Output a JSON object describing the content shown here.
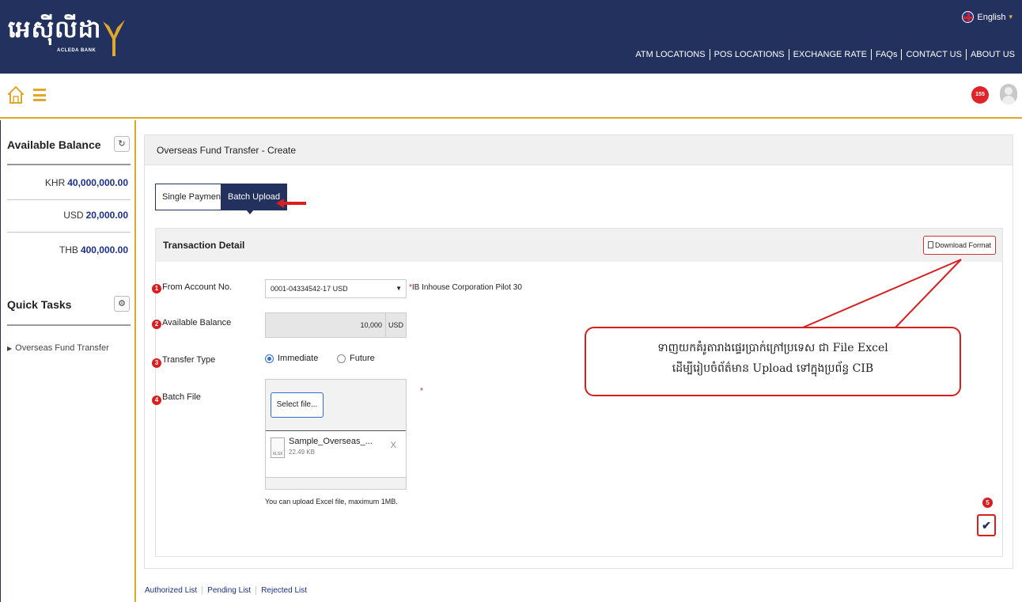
{
  "brand": {
    "logo_text": "អេស៊ីលីដា",
    "logo_sub": "ACLEDA BANK",
    "colors": {
      "navy": "#22315e",
      "gold": "#e0a72c",
      "red": "#d81e1e",
      "value_blue": "#1a2f8c"
    }
  },
  "header": {
    "language": "English",
    "nav": [
      "ATM LOCATIONS",
      "POS LOCATIONS",
      "EXCHANGE RATE",
      "FAQs",
      "CONTACT US",
      "ABOUT US"
    ],
    "notification_count": "155"
  },
  "sidebar": {
    "balance_title": "Available Balance",
    "balances": [
      {
        "currency": "KHR",
        "amount": "40,000,000.00"
      },
      {
        "currency": "USD",
        "amount": "20,000.00"
      },
      {
        "currency": "THB",
        "amount": "400,000.00"
      }
    ],
    "tasks_title": "Quick Tasks",
    "tasks": [
      "Overseas Fund Transfer"
    ]
  },
  "main": {
    "title": "Overseas Fund Transfer - Create",
    "tabs": [
      "Single Payment",
      "Batch Upload"
    ],
    "detail_title": "Transaction Detail",
    "download_label": "Download Format",
    "fields": {
      "from_account_label": "From Account No.",
      "from_account_value": "0001-04334542-17 USD",
      "account_name": "IB Inhouse Corporation Pilot 30",
      "balance_label": "Available Balance",
      "balance_value": "10,000",
      "balance_currency": "USD",
      "transfer_type_label": "Transfer Type",
      "transfer_options": [
        "Immediate",
        "Future"
      ],
      "transfer_selected": "Immediate",
      "batch_file_label": "Batch File",
      "select_file_label": "Select file...",
      "file_name": "Sample_Overseas_...",
      "file_size": "22.49 KB",
      "file_ext": "XLSX",
      "file_remove": "X",
      "upload_hint": "You can upload Excel file, maximum 1MB."
    },
    "step_numbers": [
      "1",
      "2",
      "3",
      "4",
      "5"
    ],
    "callout_line1": "ទាញយកគំរូតារាងផ្ទេរប្រាក់ក្រៅប្រទេស ជា File Excel",
    "callout_line2": "ដើម្បីរៀបចំព័ត៌មាន Upload ទៅក្នុងប្រព័ន្ធ CIB"
  },
  "footer_links": [
    "Authorized List",
    "Pending List",
    "Rejected List"
  ]
}
